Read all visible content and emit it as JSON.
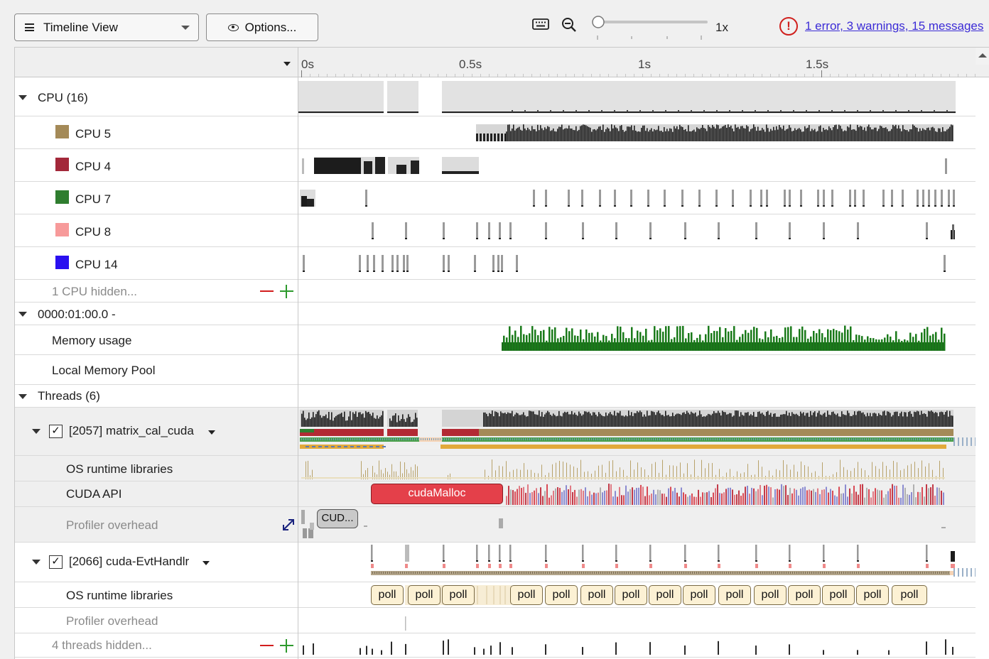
{
  "toolbar": {
    "view_select_label": "Timeline View",
    "options_label": "Options...",
    "zoom_level": "1x",
    "diagnostics_icon": "!",
    "diagnostics_link": "1 error, 3 warnings, 15 messages",
    "icons": [
      "hamburger-icon",
      "eye-icon",
      "keyboard-icon",
      "zoom-out-icon",
      "zoom-slider",
      "error-icon"
    ]
  },
  "ruler": {
    "ticks": [
      "0s",
      "0.5s",
      "1s",
      "1.5s"
    ]
  },
  "tree": {
    "cpu_group": "CPU (16)",
    "cpus": [
      {
        "label": "CPU 5",
        "color": "#a48a58"
      },
      {
        "label": "CPU 4",
        "color": "#a3283a"
      },
      {
        "label": "CPU 7",
        "color": "#2f7d2f"
      },
      {
        "label": "CPU 8",
        "color": "#f79a9a"
      },
      {
        "label": "CPU 14",
        "color": "#2a10f0"
      }
    ],
    "cpu_hidden": "1 CPU hidden...",
    "device_group": "0000:01:00.0 -",
    "memory_usage": "Memory usage",
    "local_memory_pool": "Local Memory Pool",
    "threads_group": "Threads (6)",
    "thread1": {
      "label": "[2057] matrix_cal_cuda",
      "checked": "✓",
      "os_runtime": "OS runtime libraries",
      "cuda_api": "CUDA API",
      "profiler_overhead": "Profiler overhead",
      "cuda_malloc": "cudaMalloc",
      "cud_pill": "CUD..."
    },
    "thread2": {
      "label": "[2066] cuda-EvtHandlr",
      "checked": "✓",
      "os_runtime": "OS runtime libraries",
      "profiler_overhead": "Profiler overhead",
      "poll_label": "poll"
    },
    "threads_hidden": "4 threads hidden..."
  }
}
